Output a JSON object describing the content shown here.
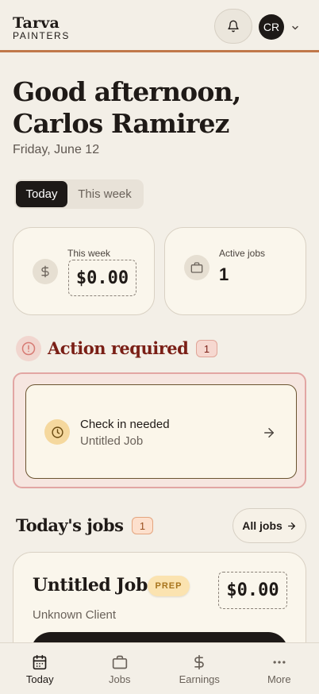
{
  "header": {
    "logo_name": "Tarva",
    "logo_sub": "PAINTERS",
    "avatar_initials": "CR",
    "accent_color": "#c0784a"
  },
  "greeting": {
    "line1": "Good afternoon,",
    "line2": "Carlos Ramirez",
    "date": "Friday, June 12"
  },
  "segmented": {
    "selected": "Today",
    "options": [
      "Today",
      "This week"
    ]
  },
  "stats": {
    "earnings": {
      "label": "This week",
      "value": "$0.00",
      "icon": "dollar-icon"
    },
    "active_jobs": {
      "label": "Active jobs",
      "value": "1",
      "icon": "briefcase-icon"
    }
  },
  "action_required": {
    "title": "Action required",
    "count": "1",
    "items": [
      {
        "title": "Check in needed",
        "subtitle": "Untitled Job",
        "icon": "clock-icon"
      }
    ]
  },
  "todays_jobs": {
    "title": "Today's jobs",
    "count": "1",
    "all_jobs_label": "All jobs",
    "jobs": [
      {
        "title": "Untitled Job",
        "status": "PREP",
        "amount": "$0.00",
        "client": "Unknown Client"
      }
    ]
  },
  "nav": {
    "items": [
      {
        "label": "Today",
        "icon": "calendar-icon",
        "active": true
      },
      {
        "label": "Jobs",
        "icon": "briefcase-icon",
        "active": false
      },
      {
        "label": "Earnings",
        "icon": "dollar-icon",
        "active": false
      },
      {
        "label": "More",
        "icon": "more-dots-icon",
        "active": false
      }
    ]
  }
}
